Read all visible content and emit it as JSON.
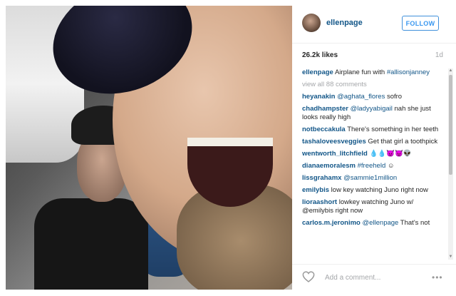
{
  "post": {
    "username": "ellenpage",
    "follow_label": "FOLLOW",
    "likes": "26.2k likes",
    "time": "1d",
    "photo_alt": "photo"
  },
  "caption": {
    "user": "ellenpage",
    "text": "Airplane fun with",
    "mention": "#allisonjanney"
  },
  "view_all": "view all 88 comments",
  "comments": [
    {
      "user": "heyanakin",
      "mention": "@aghata_flores",
      "text": " sofro"
    },
    {
      "user": "chadhampster",
      "mention": "@ladyyabigail",
      "text": " nah she just looks really high"
    },
    {
      "user": "notbeccakula",
      "mention": "",
      "text": "There's something in her teeth"
    },
    {
      "user": "tashaloveesveggies",
      "mention": "",
      "text": "Get that girl a toothpick"
    },
    {
      "user": "wentworth_litchfield",
      "mention": "",
      "text": "💧💧😈😈👽"
    },
    {
      "user": "dianaemoralesm",
      "mention": "#freeheld",
      "text": " ☺"
    },
    {
      "user": "lissgrahamx",
      "mention": "@sammie1million",
      "text": ""
    },
    {
      "user": "emilybis",
      "mention": "",
      "text": "low key watching Juno right now"
    },
    {
      "user": "lioraashort",
      "mention": "",
      "text": "lowkey watching Juno w/ @emilybis right now"
    },
    {
      "user": "carlos.m.jeronimo",
      "mention": "@ellenpage",
      "text": " That's not"
    }
  ],
  "footer": {
    "comment_placeholder": "Add a comment...",
    "more_label": "•••"
  },
  "scrollbar": {
    "up": "▲",
    "down": "▼"
  }
}
